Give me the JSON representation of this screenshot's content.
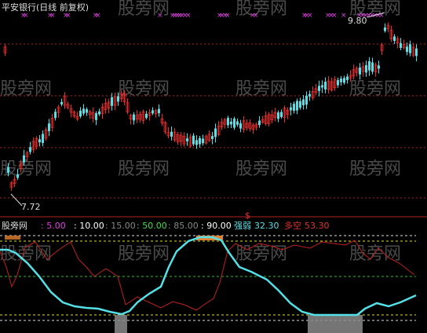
{
  "title": "平安银行(日线 前复权)",
  "price_high_label": "9.80",
  "price_low_label": "7.72",
  "watermark": "股旁网",
  "indicator": {
    "name": "股旁网",
    "levels": [
      {
        "text": ": 5.00",
        "color": "#e040e0"
      },
      {
        "text": ": 10.00",
        "color": "#ffffff"
      },
      {
        "text": ": 15.00",
        "color": "#888888"
      },
      {
        "text": ": 50.00",
        "color": "#44dd44"
      },
      {
        "text": ": 85.00",
        "color": "#888888"
      },
      {
        "text": ": 90.00",
        "color": "#ffffff"
      }
    ],
    "strong_label": "强弱",
    "strong_value": "32.30",
    "strong_color": "#55e0e8",
    "dual_label": "多空",
    "dual_value": "53.30",
    "dual_color": "#e03030"
  },
  "colors": {
    "up": "#e03030",
    "down": "#55e0e8",
    "marker": "#e040e0",
    "grid_red": "#b02020",
    "level_yellow": "#e0e020",
    "level_green": "#30c030",
    "level_white": "#dddddd"
  }
}
